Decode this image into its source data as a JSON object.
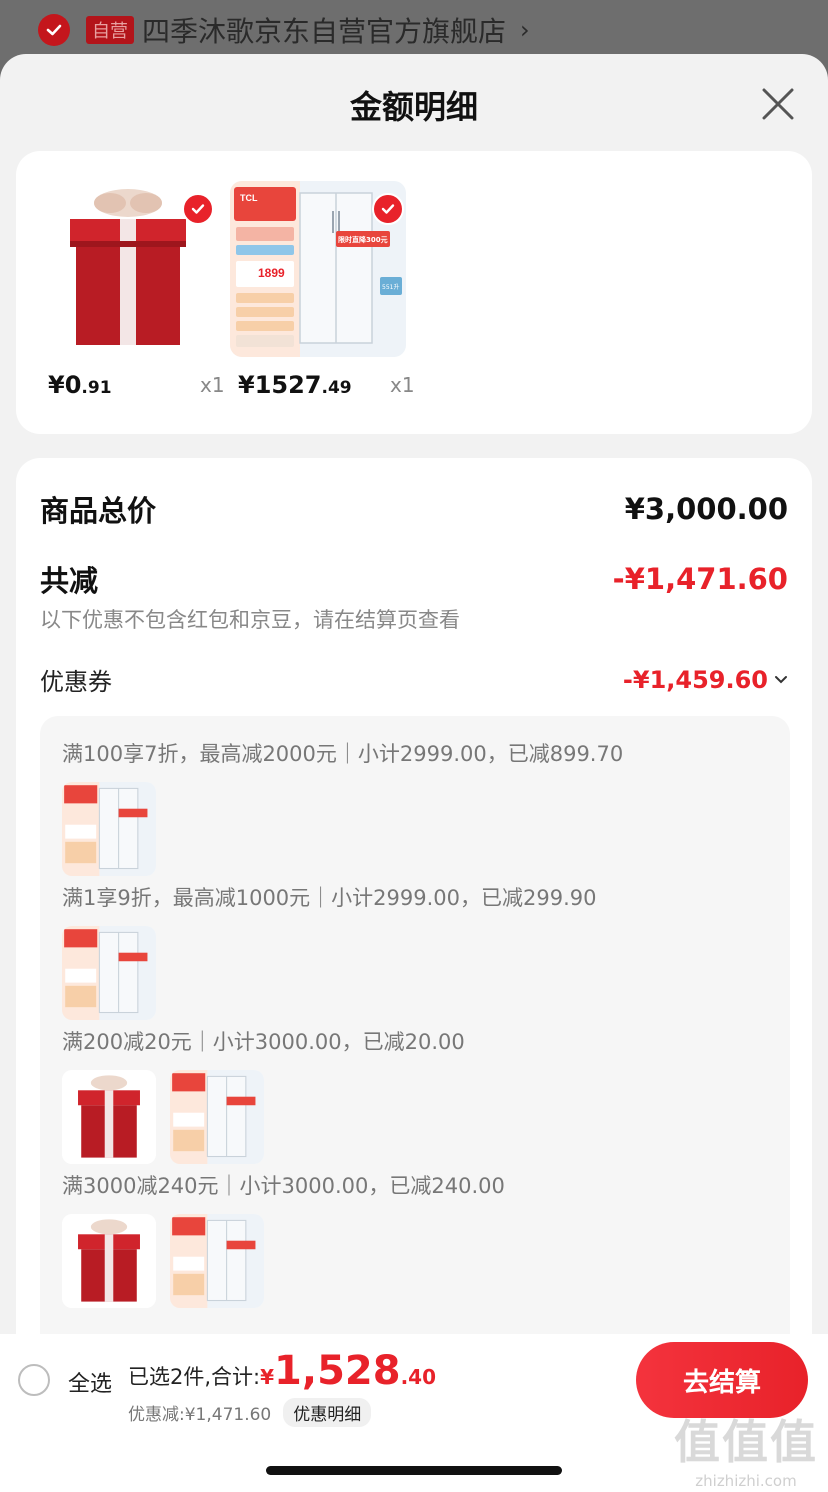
{
  "store": {
    "tag": "自营",
    "name": "四季沐歌京东自营官方旗舰店"
  },
  "sheet": {
    "title": "金额明细"
  },
  "products": [
    {
      "type": "gift",
      "price_int": "¥0",
      "price_dec": ".91",
      "qty": "x1",
      "checked": true
    },
    {
      "type": "fridge",
      "price_int": "¥1527",
      "price_dec": ".49",
      "qty": "x1",
      "checked": true
    }
  ],
  "fridge_thumb_text": {
    "brand": "TCL",
    "price_tag": "1899",
    "promo": "限时直降300元",
    "size": "551升"
  },
  "summary": {
    "total_label": "商品总价",
    "total_value": "¥3,000.00",
    "reduce_label": "共减",
    "reduce_value": "-¥1,471.60",
    "note": "以下优惠不包含红包和京豆，请在结算页查看",
    "coupon_label": "优惠券",
    "coupon_value": "-¥1,459.60"
  },
  "coupon_rules": [
    {
      "text": "满100享7折，最高减2000元｜小计2999.00，已减899.70",
      "items": [
        "fridge"
      ]
    },
    {
      "text": "满1享9折，最高减1000元｜小计2999.00，已减299.90",
      "items": [
        "fridge"
      ]
    },
    {
      "text": "满200减20元｜小计3000.00，已减20.00",
      "items": [
        "gift",
        "fridge"
      ]
    },
    {
      "text": "满3000减240元｜小计3000.00，已减240.00",
      "items": [
        "gift",
        "fridge"
      ]
    }
  ],
  "bottom": {
    "select_all": "全选",
    "selected_label": "已选2件,合计:",
    "currency": "¥",
    "total_int": "1,528",
    "total_dec": ".40",
    "saved": "优惠减:¥1,471.60",
    "detail_chip": "优惠明细",
    "checkout": "去结算"
  },
  "watermark": {
    "logo": "值值值",
    "url": "zhizhizhi.com"
  },
  "colors": {
    "accent_red": "#e8222a",
    "gift_red": "#c8202a"
  }
}
